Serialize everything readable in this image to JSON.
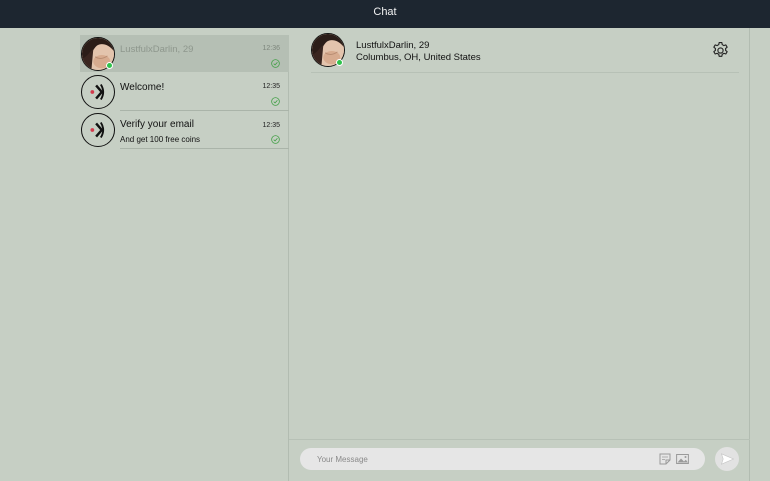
{
  "header": {
    "title": "Chat"
  },
  "conversations": [
    {
      "name": "LustfulxDarlin, 29",
      "subtitle": "",
      "time": "12:36",
      "selected": true,
      "avatar": "profile-photo",
      "online": true
    },
    {
      "name": "Welcome!",
      "subtitle": "",
      "time": "12:35",
      "selected": false,
      "avatar": "system-logo-icon",
      "online": false
    },
    {
      "name": "Verify your email",
      "subtitle": "And get 100 free coins",
      "time": "12:35",
      "selected": false,
      "avatar": "system-logo-icon",
      "online": false
    }
  ],
  "chat": {
    "name": "LustfulxDarlin, 29",
    "location": "Columbus, OH, United States",
    "online": true
  },
  "composer": {
    "placeholder": "Your Message",
    "icons": [
      "sticker-icon",
      "image-icon",
      "send-icon"
    ]
  },
  "colors": {
    "topbar": "#1d2630",
    "background": "#c6cfc4",
    "selected_row": "#b5bfb4",
    "online": "#2ec24b",
    "read_check": "#43a047"
  }
}
